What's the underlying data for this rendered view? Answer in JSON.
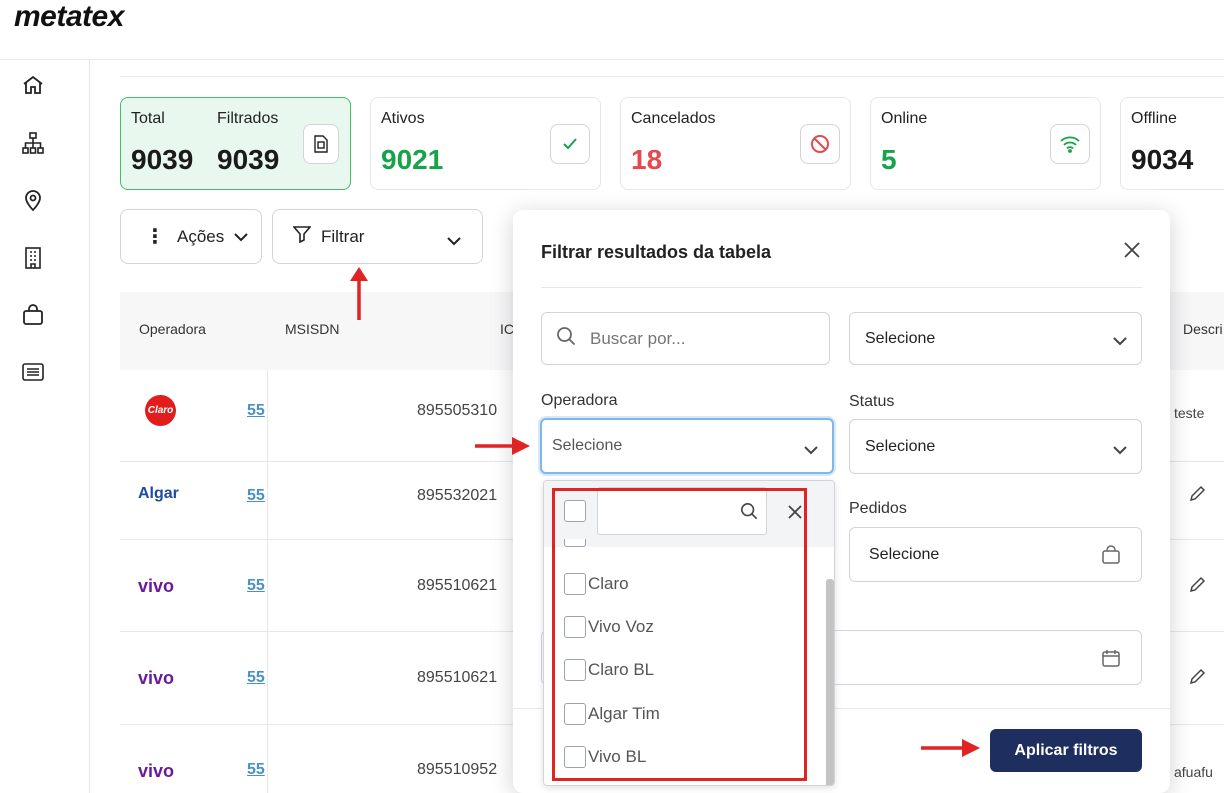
{
  "app": {
    "logo": "metatex"
  },
  "sidebar": {
    "icons": [
      "home-icon",
      "sitemap-icon",
      "location-pin-icon",
      "building-icon",
      "shopping-bag-icon",
      "list-icon"
    ]
  },
  "stats": {
    "total": {
      "label": "Total",
      "value": "9039",
      "filtered_label": "Filtrados",
      "filtered_value": "9039",
      "icon": "sim-card-icon"
    },
    "ativos": {
      "label": "Ativos",
      "value": "9021",
      "color": "#16a34a",
      "icon": "check-icon"
    },
    "cancelados": {
      "label": "Cancelados",
      "value": "18",
      "color": "#e5484d",
      "icon": "ban-icon"
    },
    "online": {
      "label": "Online",
      "value": "5",
      "color": "#16a34a",
      "icon": "wifi-icon"
    },
    "offline": {
      "label": "Offline",
      "value": "9034"
    }
  },
  "toolbar": {
    "actions_label": "Ações",
    "filter_label": "Filtrar"
  },
  "table": {
    "headers": {
      "operadora": "Operadora",
      "msisdn": "MSISDN",
      "iccid": "IC",
      "descricao": "Descri"
    },
    "rows": [
      {
        "operator": "Claro",
        "msisdn": "55",
        "iccid": "895505310",
        "desc": "teste"
      },
      {
        "operator": "Algar",
        "msisdn": "55",
        "iccid": "895532021",
        "desc": ""
      },
      {
        "operator": "vivo",
        "msisdn": "55",
        "iccid": "895510621",
        "desc": ""
      },
      {
        "operator": "vivo",
        "msisdn": "55",
        "iccid": "895510621",
        "desc": ""
      },
      {
        "operator": "vivo",
        "msisdn": "55",
        "iccid": "895510952",
        "desc": "afuafu"
      }
    ]
  },
  "filter_modal": {
    "title": "Filtrar resultados da tabela",
    "search_placeholder": "Buscar por...",
    "top_select": "Selecione",
    "operadora_label": "Operadora",
    "operadora_value": "Selecione",
    "status_label": "Status",
    "status_value": "Selecione",
    "pedidos_label": "Pedidos",
    "pedidos_value": "Selecione",
    "apply_label": "Aplicar filtros"
  },
  "operator_dropdown": {
    "options": [
      "Claro",
      "Vivo Voz",
      "Claro BL",
      "Algar Tim",
      "Vivo BL"
    ]
  }
}
